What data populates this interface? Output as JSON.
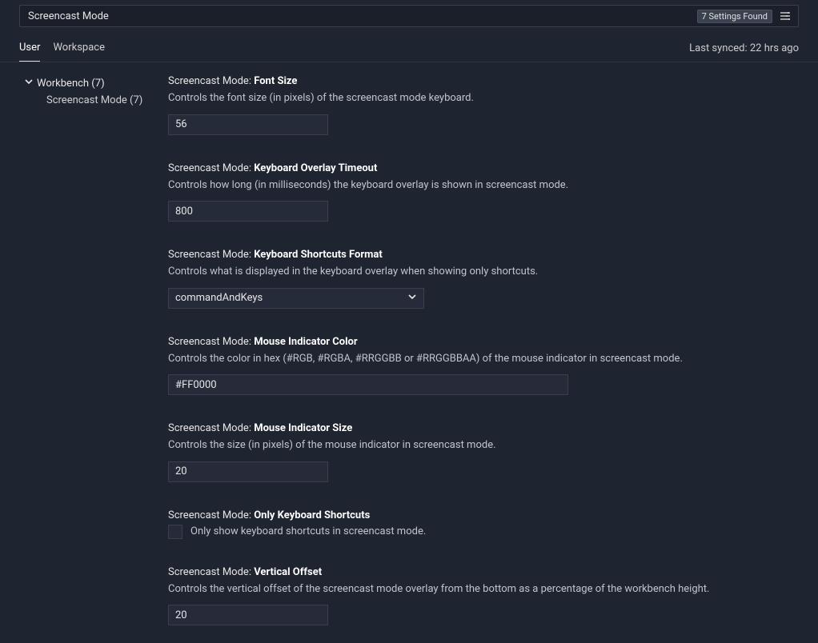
{
  "search": {
    "query": "Screencast Mode",
    "results_badge": "7 Settings Found"
  },
  "tabs": {
    "user": "User",
    "workspace": "Workspace"
  },
  "sync_status": "Last synced: 22 hrs ago",
  "sidebar": {
    "parent_label": "Workbench (7)",
    "child_label": "Screencast Mode (7)"
  },
  "settings": [
    {
      "prefix": "Screencast Mode: ",
      "name": "Font Size",
      "description": "Controls the font size (in pixels) of the screencast mode keyboard.",
      "type": "number",
      "value": "56"
    },
    {
      "prefix": "Screencast Mode: ",
      "name": "Keyboard Overlay Timeout",
      "description": "Controls how long (in milliseconds) the keyboard overlay is shown in screencast mode.",
      "type": "number",
      "value": "800"
    },
    {
      "prefix": "Screencast Mode: ",
      "name": "Keyboard Shortcuts Format",
      "description": "Controls what is displayed in the keyboard overlay when showing only shortcuts.",
      "type": "select",
      "value": "commandAndKeys"
    },
    {
      "prefix": "Screencast Mode: ",
      "name": "Mouse Indicator Color",
      "description": "Controls the color in hex (#RGB, #RGBA, #RRGGBB or #RRGGBBAA) of the mouse indicator in screencast mode.",
      "type": "text-wide",
      "value": "#FF0000"
    },
    {
      "prefix": "Screencast Mode: ",
      "name": "Mouse Indicator Size",
      "description": "Controls the size (in pixels) of the mouse indicator in screencast mode.",
      "type": "number",
      "value": "20"
    },
    {
      "prefix": "Screencast Mode: ",
      "name": "Only Keyboard Shortcuts",
      "description": "Only show keyboard shortcuts in screencast mode.",
      "type": "checkbox",
      "checked": false
    },
    {
      "prefix": "Screencast Mode: ",
      "name": "Vertical Offset",
      "description": "Controls the vertical offset of the screencast mode overlay from the bottom as a percentage of the workbench height.",
      "type": "number",
      "value": "20"
    }
  ]
}
